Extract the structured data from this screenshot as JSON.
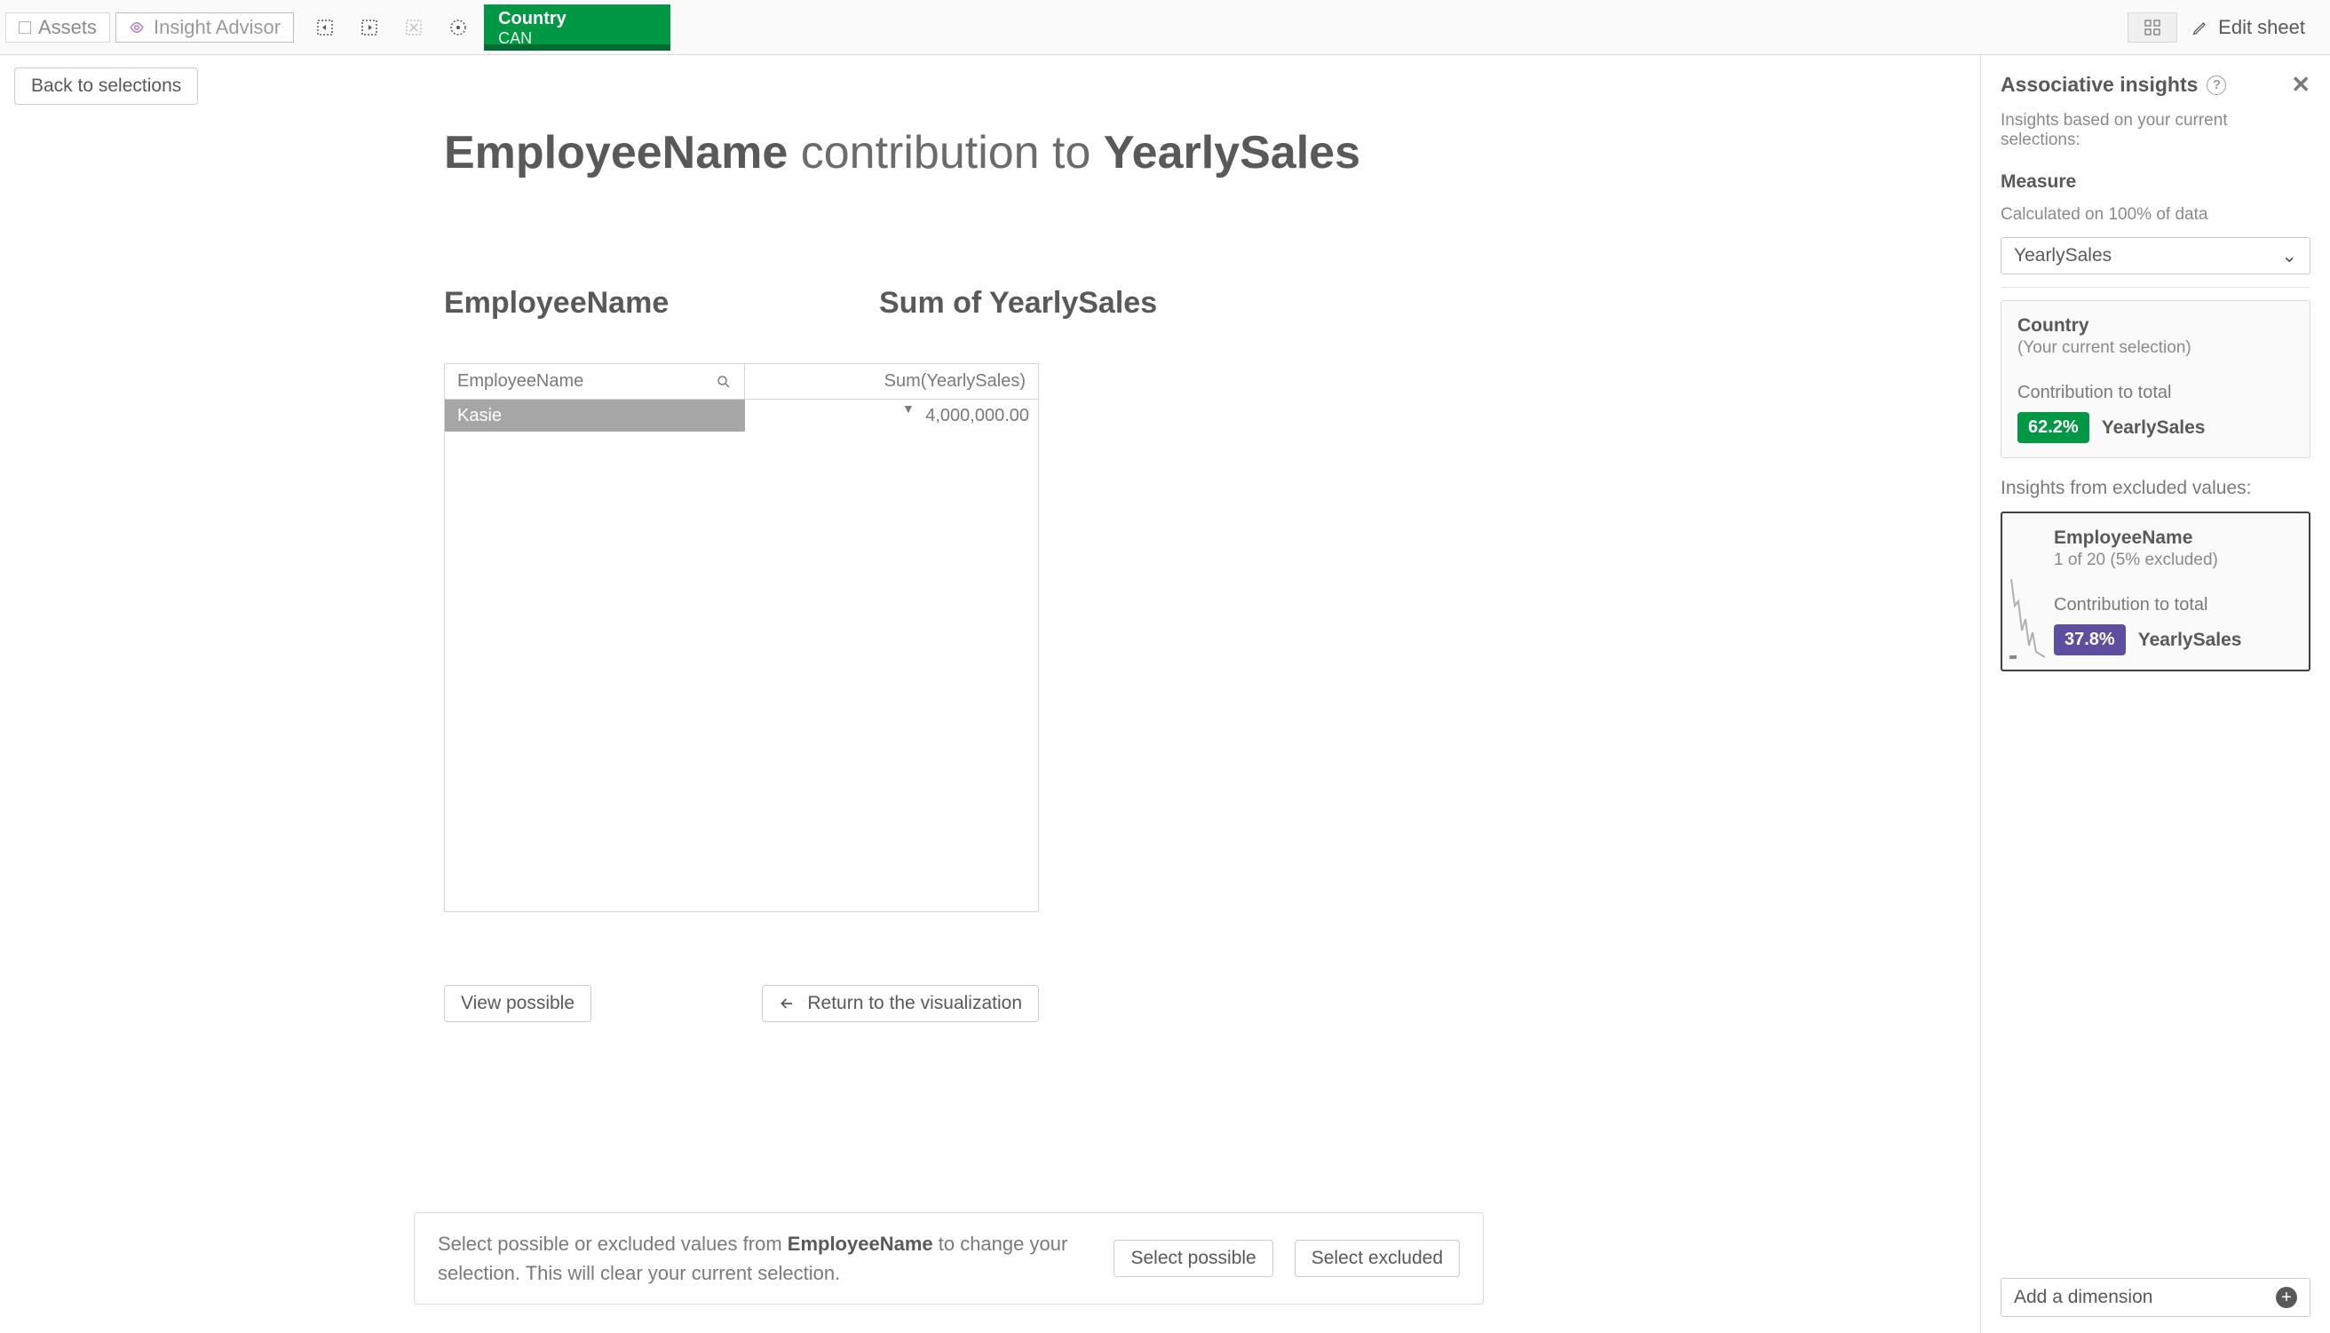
{
  "toolbar": {
    "assets_label": "Assets",
    "insight_label": "Insight Advisor",
    "selection": {
      "field": "Country",
      "value": "CAN"
    },
    "edit_label": "Edit sheet"
  },
  "main": {
    "back_label": "Back to selections",
    "title_part1": "EmployeeName",
    "title_mid": " contribution to ",
    "title_part2": "YearlySales",
    "left_header": "EmployeeName",
    "right_header": "Sum of YearlySales",
    "table": {
      "col1": "EmployeeName",
      "col2": "Sum(YearlySales)",
      "rows": [
        {
          "name": "Kasie",
          "value": "4,000,000.00"
        }
      ]
    },
    "view_possible_label": "View possible",
    "return_label": "Return to the visualization",
    "help_pre": "Select possible or excluded values from ",
    "help_bold": "EmployeeName",
    "help_post": " to change your selection. This will clear your current selection.",
    "select_possible_label": "Select possible",
    "select_excluded_label": "Select excluded"
  },
  "side": {
    "title": "Associative insights",
    "subtitle": "Insights based on your current selections:",
    "measure_label": "Measure",
    "measure_hint": "Calculated on 100% of data",
    "measure_value": "YearlySales",
    "card_country": {
      "title": "Country",
      "sub": "(Your current selection)",
      "contrib_label": "Contribution to total",
      "pct": "62.2%",
      "pct_measure": "YearlySales"
    },
    "excluded_header": "Insights from excluded values:",
    "card_employee": {
      "title": "EmployeeName",
      "sub": "1 of 20 (5% excluded)",
      "contrib_label": "Contribution to total",
      "pct": "37.8%",
      "pct_measure": "YearlySales"
    },
    "add_dimension_label": "Add a dimension"
  },
  "chart_data": {
    "type": "table",
    "columns": [
      "EmployeeName",
      "Sum(YearlySales)"
    ],
    "rows": [
      [
        "Kasie",
        4000000.0
      ]
    ]
  }
}
